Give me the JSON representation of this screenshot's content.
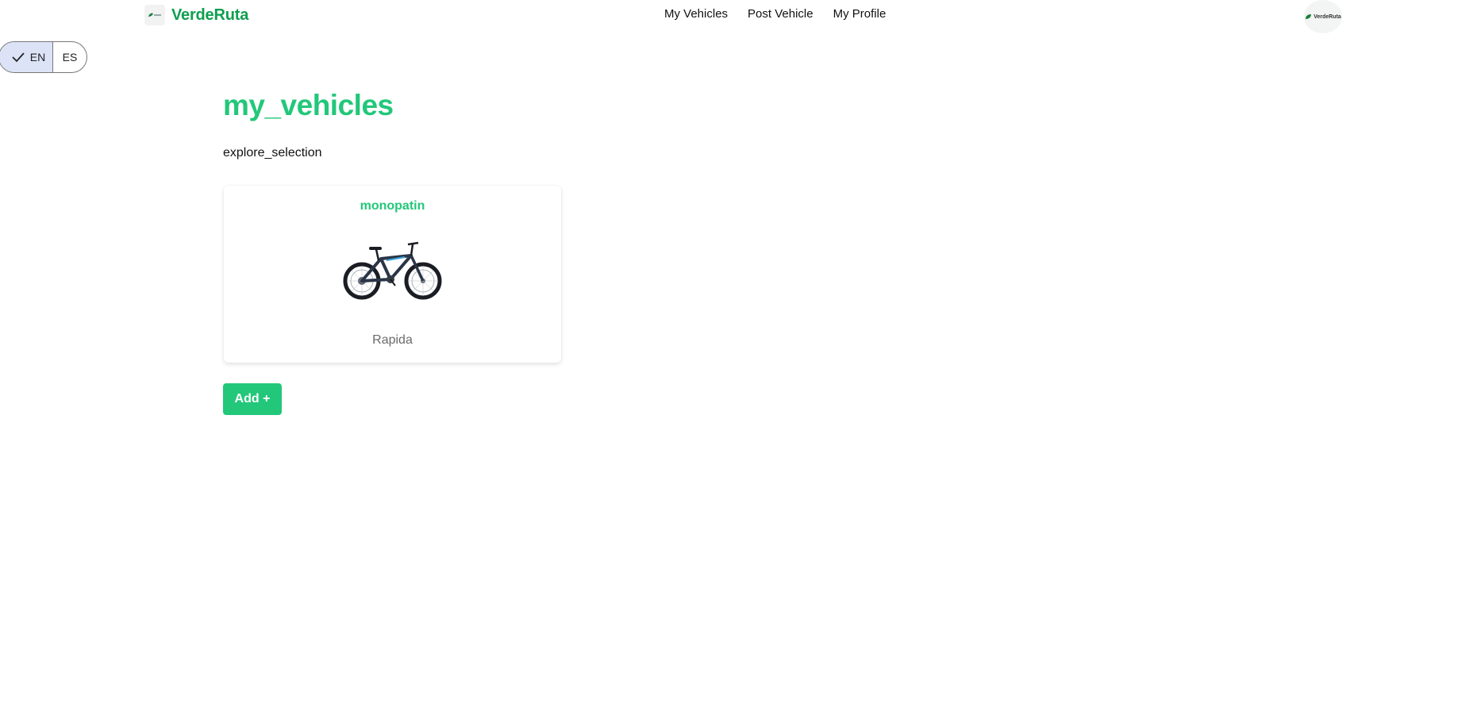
{
  "brand": {
    "name": "VerdeRuta",
    "logo_icon": "leaf-icon"
  },
  "nav": {
    "items": [
      {
        "label": "My Vehicles"
      },
      {
        "label": "Post Vehicle"
      },
      {
        "label": "My Profile"
      }
    ]
  },
  "avatar": {
    "label": "VerdeRuta",
    "icon": "leaf-icon"
  },
  "language": {
    "options": [
      {
        "code": "EN",
        "selected": true,
        "icon": "checkmark-icon"
      },
      {
        "code": "ES",
        "selected": false
      }
    ]
  },
  "page": {
    "title": "my_vehicles",
    "subtitle": "explore_selection"
  },
  "vehicles": [
    {
      "name": "monopatin",
      "image_icon": "bicycle-image",
      "description": "Rapida"
    }
  ],
  "actions": {
    "add_label": "Add +"
  },
  "colors": {
    "brand_green": "#0e9f4f",
    "accent_green": "#22c77a",
    "selected_lang_bg": "#dce3f7",
    "caption_gray": "#6b6b6b"
  }
}
